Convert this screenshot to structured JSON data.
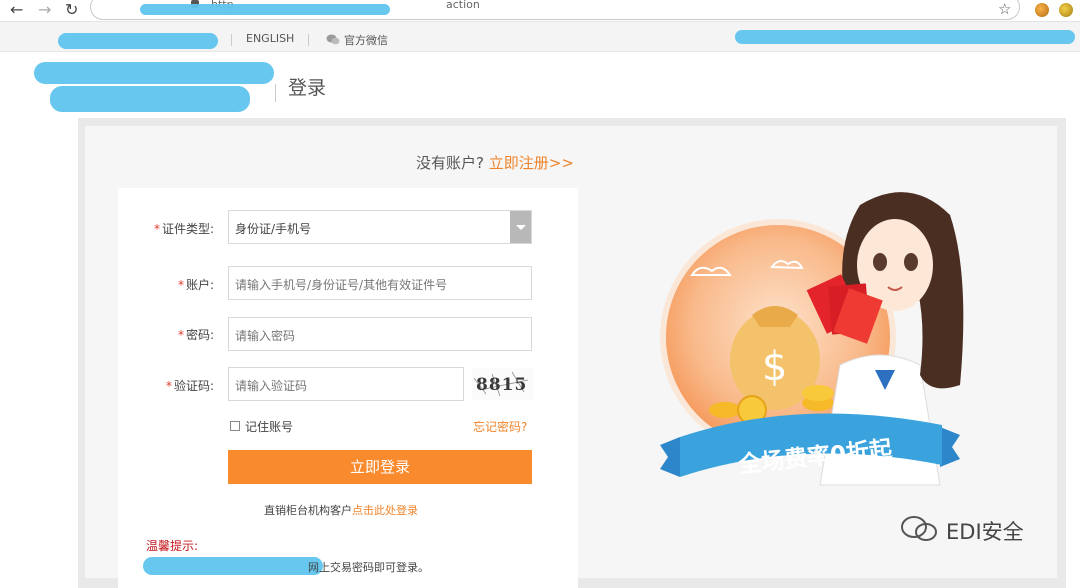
{
  "browser": {
    "url_start": "http",
    "url_end": "action"
  },
  "topbar": {
    "english": "ENGLISH",
    "wechat": "官方微信"
  },
  "page": {
    "title": "登录"
  },
  "form": {
    "no_account": "没有账户?",
    "register_link": "立即注册>>",
    "id_type_label": "证件类型:",
    "id_type_value": "身份证/手机号",
    "account_label": "账户:",
    "account_placeholder": "请输入手机号/身份证号/其他有效证件号",
    "password_label": "密码:",
    "password_placeholder": "请输入密码",
    "captcha_label": "验证码:",
    "captcha_placeholder": "请输入验证码",
    "captcha_text": "8815",
    "remember": "记住账号",
    "forgot": "忘记密码?",
    "login_button": "立即登录",
    "direct_prefix": "直销柜台机构客户",
    "direct_link": "点击此处登录",
    "tip_label": "温馨提示:",
    "tip_tail": "网上交易密码即可登录。"
  },
  "promo": {
    "banner": "全场费率0折起",
    "coin_symbol": "$"
  },
  "watermark": {
    "text": "EDI安全"
  },
  "colors": {
    "accent": "#f98a2d",
    "link": "#f0842a",
    "required": "#e23b2e",
    "tip": "#c4161c",
    "banner": "#3aa3dd"
  }
}
